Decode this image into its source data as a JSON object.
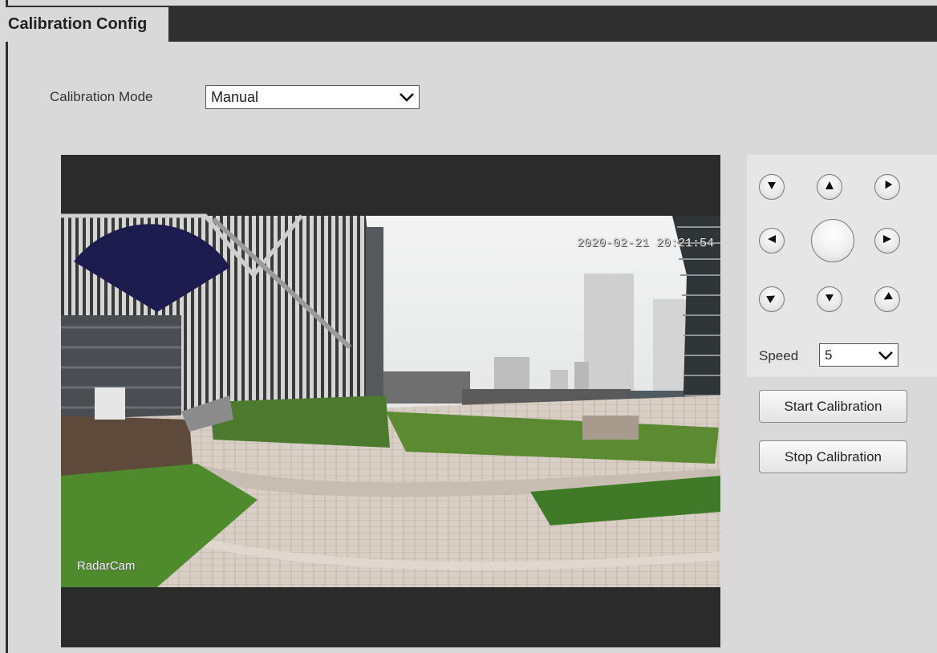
{
  "tab": {
    "title": "Calibration Config"
  },
  "calibration_mode": {
    "label": "Calibration Mode",
    "value": "Manual"
  },
  "video": {
    "timestamp": "2020-02-21 20:21:54",
    "camera_name": "RadarCam"
  },
  "ptz": {
    "buttons": [
      "up-left",
      "up",
      "up-right",
      "left",
      "center",
      "right",
      "down-left",
      "down",
      "down-right"
    ]
  },
  "speed": {
    "label": "Speed",
    "value": "5"
  },
  "actions": {
    "start": "Start Calibration",
    "stop": "Stop Calibration"
  },
  "colors": {
    "frame": "#2f2f2f",
    "background": "#d9d9d9",
    "radar_sector": "#1c1b4e"
  }
}
